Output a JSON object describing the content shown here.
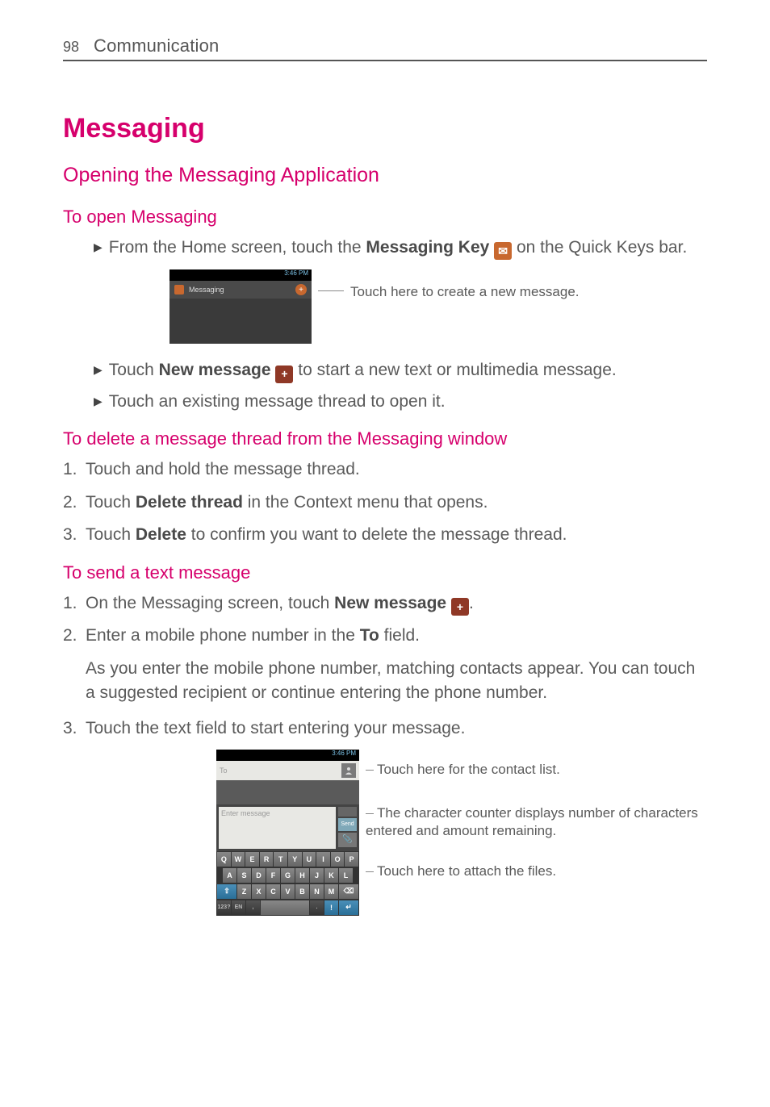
{
  "header": {
    "page_number": "98",
    "section": "Communication"
  },
  "h1": "Messaging",
  "h2": "Opening the Messaging Application",
  "sectA": {
    "heading": "To open Messaging",
    "bullet1_a": "From the Home screen, touch the ",
    "bullet1_b": "Messaging Key",
    "bullet1_c": " on the Quick Keys bar.",
    "ss1_time": "3:46 PM",
    "ss1_title": "Messaging",
    "ss1_callout": "Touch here to create a new message.",
    "bullet2_a": "Touch ",
    "bullet2_b": "New message",
    "bullet2_c": " to start a new text or multimedia message.",
    "bullet3": "Touch an existing message thread to open it."
  },
  "sectB": {
    "heading": "To delete a message thread from the Messaging window",
    "step1": "Touch and hold the message thread.",
    "step2_a": "Touch ",
    "step2_b": "Delete thread",
    "step2_c": " in the Context menu that opens.",
    "step3_a": "Touch ",
    "step3_b": "Delete",
    "step3_c": " to confirm you want to delete the message thread."
  },
  "sectC": {
    "heading": "To send a text message",
    "step1_a": "On the Messaging screen, touch ",
    "step1_b": "New message",
    "step1_c": ".",
    "step2_a": "Enter a mobile phone number in the ",
    "step2_b": "To",
    "step2_c": " field.",
    "step2_para": "As you enter the mobile phone number, matching contacts appear. You can touch a suggested recipient or continue entering the phone number.",
    "step3": "Touch the text field to start entering your message.",
    "ss2_time": "3:46 PM",
    "ss2_to_ph": "To",
    "ss2_msg_ph": "Enter message",
    "ss2_send": "Send",
    "annot1": "Touch here for the contact list.",
    "annot2": "The character counter displays number of characters entered and amount remaining.",
    "annot3": "Touch here to attach the files.",
    "keys_r1": [
      "Q",
      "W",
      "E",
      "R",
      "T",
      "Y",
      "U",
      "I",
      "O",
      "P"
    ],
    "keys_r2": [
      "A",
      "S",
      "D",
      "F",
      "G",
      "H",
      "J",
      "K",
      "L"
    ],
    "keys_r3": [
      "Z",
      "X",
      "C",
      "V",
      "B",
      "N",
      "M"
    ],
    "keys_r4": [
      "123?",
      "EN",
      ",",
      "space",
      ".",
      "!",
      "↵"
    ]
  }
}
